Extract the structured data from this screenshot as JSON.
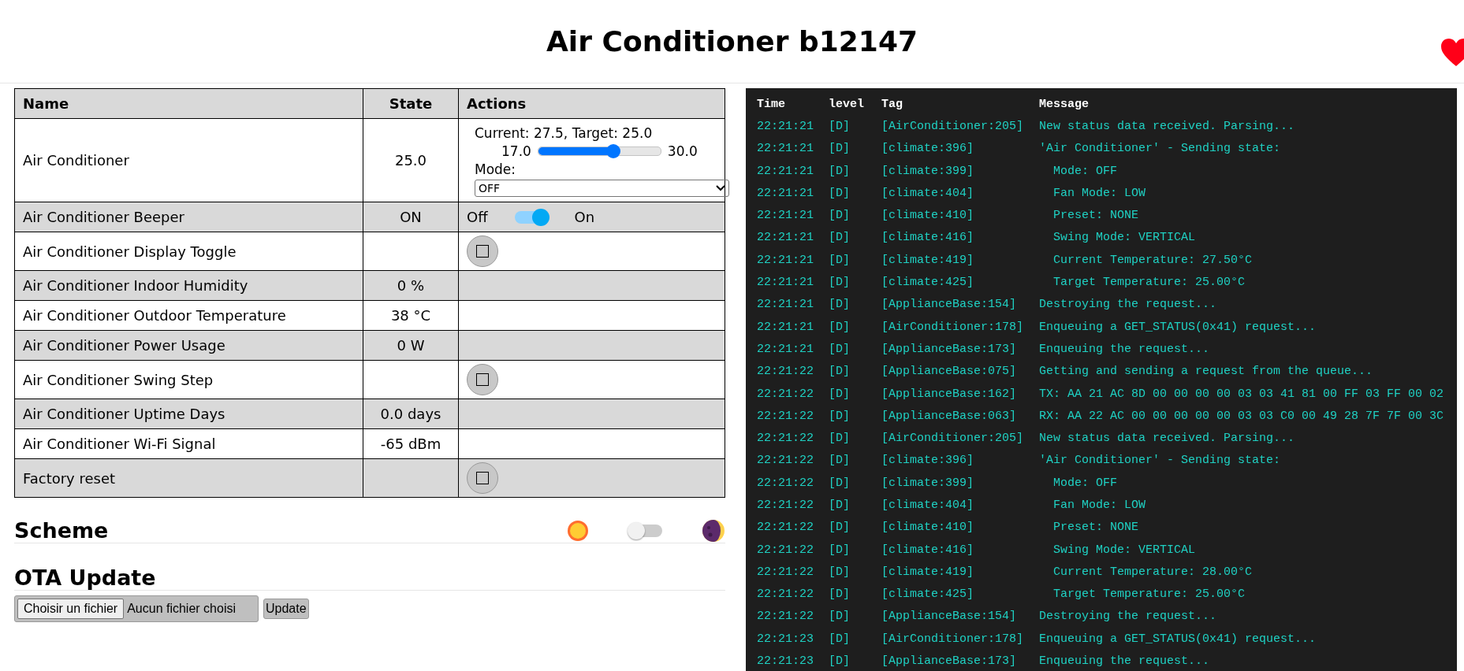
{
  "header": {
    "title": "Air Conditioner b12147"
  },
  "entities": {
    "columns": [
      "Name",
      "State",
      "Actions"
    ],
    "rows": [
      {
        "kind": "climate",
        "name": "Air Conditioner",
        "state": "25.0",
        "current": "Current: 27.5, Target: 25.0",
        "min": "17.0",
        "max": "30.0",
        "level": 0.615,
        "mode_label": "Mode:",
        "mode": "OFF"
      },
      {
        "kind": "switch",
        "name": "Air Conditioner Beeper",
        "state": "ON",
        "off_label": "Off",
        "on_label": "On",
        "on": true
      },
      {
        "kind": "button",
        "name": "Air Conditioner Display Toggle",
        "state": ""
      },
      {
        "kind": "none",
        "name": "Air Conditioner Indoor Humidity",
        "state": "0 %"
      },
      {
        "kind": "none",
        "name": "Air Conditioner Outdoor Temperature",
        "state": "38 °C"
      },
      {
        "kind": "none",
        "name": "Air Conditioner Power Usage",
        "state": "0 W"
      },
      {
        "kind": "button",
        "name": "Air Conditioner Swing Step",
        "state": ""
      },
      {
        "kind": "none",
        "name": "Air Conditioner Uptime Days",
        "state": "0.0 days"
      },
      {
        "kind": "none",
        "name": "Air Conditioner Wi-Fi Signal",
        "state": "-65 dBm"
      },
      {
        "kind": "button",
        "name": "Factory reset",
        "state": ""
      }
    ]
  },
  "scheme": {
    "title": "Scheme",
    "dark": false
  },
  "ota": {
    "title": "OTA Update",
    "file_button": "Choisir un fichier",
    "file_status": "Aucun fichier choisi",
    "update_button": "Update"
  },
  "log": {
    "columns": [
      "Time",
      "level",
      "Tag",
      "Message"
    ],
    "rows": [
      [
        "22:21:21",
        "[D]",
        "[AirConditioner:205]",
        "New status data received. Parsing..."
      ],
      [
        "22:21:21",
        "[D]",
        "[climate:396]",
        "'Air Conditioner' - Sending state:"
      ],
      [
        "22:21:21",
        "[D]",
        "[climate:399]",
        "  Mode: OFF"
      ],
      [
        "22:21:21",
        "[D]",
        "[climate:404]",
        "  Fan Mode: LOW"
      ],
      [
        "22:21:21",
        "[D]",
        "[climate:410]",
        "  Preset: NONE"
      ],
      [
        "22:21:21",
        "[D]",
        "[climate:416]",
        "  Swing Mode: VERTICAL"
      ],
      [
        "22:21:21",
        "[D]",
        "[climate:419]",
        "  Current Temperature: 27.50°C"
      ],
      [
        "22:21:21",
        "[D]",
        "[climate:425]",
        "  Target Temperature: 25.00°C"
      ],
      [
        "22:21:21",
        "[D]",
        "[ApplianceBase:154]",
        "Destroying the request..."
      ],
      [
        "22:21:21",
        "[D]",
        "[AirConditioner:178]",
        "Enqueuing a GET_STATUS(0x41) request..."
      ],
      [
        "22:21:21",
        "[D]",
        "[ApplianceBase:173]",
        "Enqueuing the request..."
      ],
      [
        "22:21:22",
        "[D]",
        "[ApplianceBase:075]",
        "Getting and sending a request from the queue..."
      ],
      [
        "22:21:22",
        "[D]",
        "[ApplianceBase:162]",
        "TX: AA 21 AC 8D 00 00 00 00 03 03 41 81 00 FF 03 FF 00 02"
      ],
      [
        "22:21:22",
        "[D]",
        "[ApplianceBase:063]",
        "RX: AA 22 AC 00 00 00 00 00 03 03 C0 00 49 28 7F 7F 00 3C"
      ],
      [
        "22:21:22",
        "[D]",
        "[AirConditioner:205]",
        "New status data received. Parsing..."
      ],
      [
        "22:21:22",
        "[D]",
        "[climate:396]",
        "'Air Conditioner' - Sending state:"
      ],
      [
        "22:21:22",
        "[D]",
        "[climate:399]",
        "  Mode: OFF"
      ],
      [
        "22:21:22",
        "[D]",
        "[climate:404]",
        "  Fan Mode: LOW"
      ],
      [
        "22:21:22",
        "[D]",
        "[climate:410]",
        "  Preset: NONE"
      ],
      [
        "22:21:22",
        "[D]",
        "[climate:416]",
        "  Swing Mode: VERTICAL"
      ],
      [
        "22:21:22",
        "[D]",
        "[climate:419]",
        "  Current Temperature: 28.00°C"
      ],
      [
        "22:21:22",
        "[D]",
        "[climate:425]",
        "  Target Temperature: 25.00°C"
      ],
      [
        "22:21:22",
        "[D]",
        "[ApplianceBase:154]",
        "Destroying the request..."
      ],
      [
        "22:21:23",
        "[D]",
        "[AirConditioner:178]",
        "Enqueuing a GET_STATUS(0x41) request..."
      ],
      [
        "22:21:23",
        "[D]",
        "[ApplianceBase:173]",
        "Enqueuing the request..."
      ]
    ]
  }
}
